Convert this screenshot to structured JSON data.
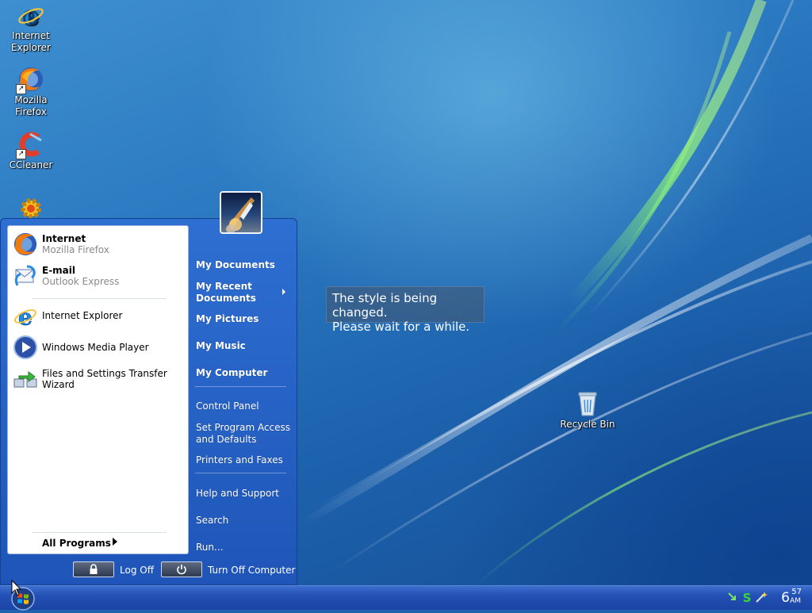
{
  "desktop": {
    "icons": [
      {
        "name": "internet-explorer",
        "label_line1": "Internet",
        "label_line2": "Explorer"
      },
      {
        "name": "mozilla-firefox",
        "label_line1": "Mozilla",
        "label_line2": "Firefox"
      },
      {
        "name": "ccleaner",
        "label_line1": "CCleaner",
        "label_line2": ""
      },
      {
        "name": "recycle-bin",
        "label_line1": "Recycle Bin",
        "label_line2": ""
      }
    ],
    "notification": {
      "line1": "The style is being changed.",
      "line2": "Please wait for a while."
    }
  },
  "start_menu": {
    "pinned": [
      {
        "title": "Internet",
        "subtitle": "Mozilla Firefox"
      },
      {
        "title": "E-mail",
        "subtitle": "Outlook Express"
      }
    ],
    "recent": [
      {
        "label": "Internet Explorer"
      },
      {
        "label": "Windows Media Player"
      },
      {
        "label": "Files and Settings Transfer Wizard"
      }
    ],
    "all_programs": "All Programs",
    "places": [
      {
        "line1": "My Documents"
      },
      {
        "line1": "My Recent",
        "line2": "Documents"
      },
      {
        "line1": "My Pictures"
      },
      {
        "line1": "My Music"
      },
      {
        "line1": "My Computer"
      }
    ],
    "system": [
      {
        "line1": "Control Panel"
      },
      {
        "line1": "Set Program Access",
        "line2": "and Defaults"
      },
      {
        "line1": "Printers and Faxes"
      }
    ],
    "tools": [
      {
        "line1": "Help and Support"
      },
      {
        "line1": "Search"
      },
      {
        "line1": "Run..."
      }
    ],
    "log_off": "Log Off",
    "turn_off": "Turn Off Computer"
  },
  "taskbar": {
    "clock_hour": "6",
    "clock_minute": "57",
    "clock_ampm": "AM"
  }
}
